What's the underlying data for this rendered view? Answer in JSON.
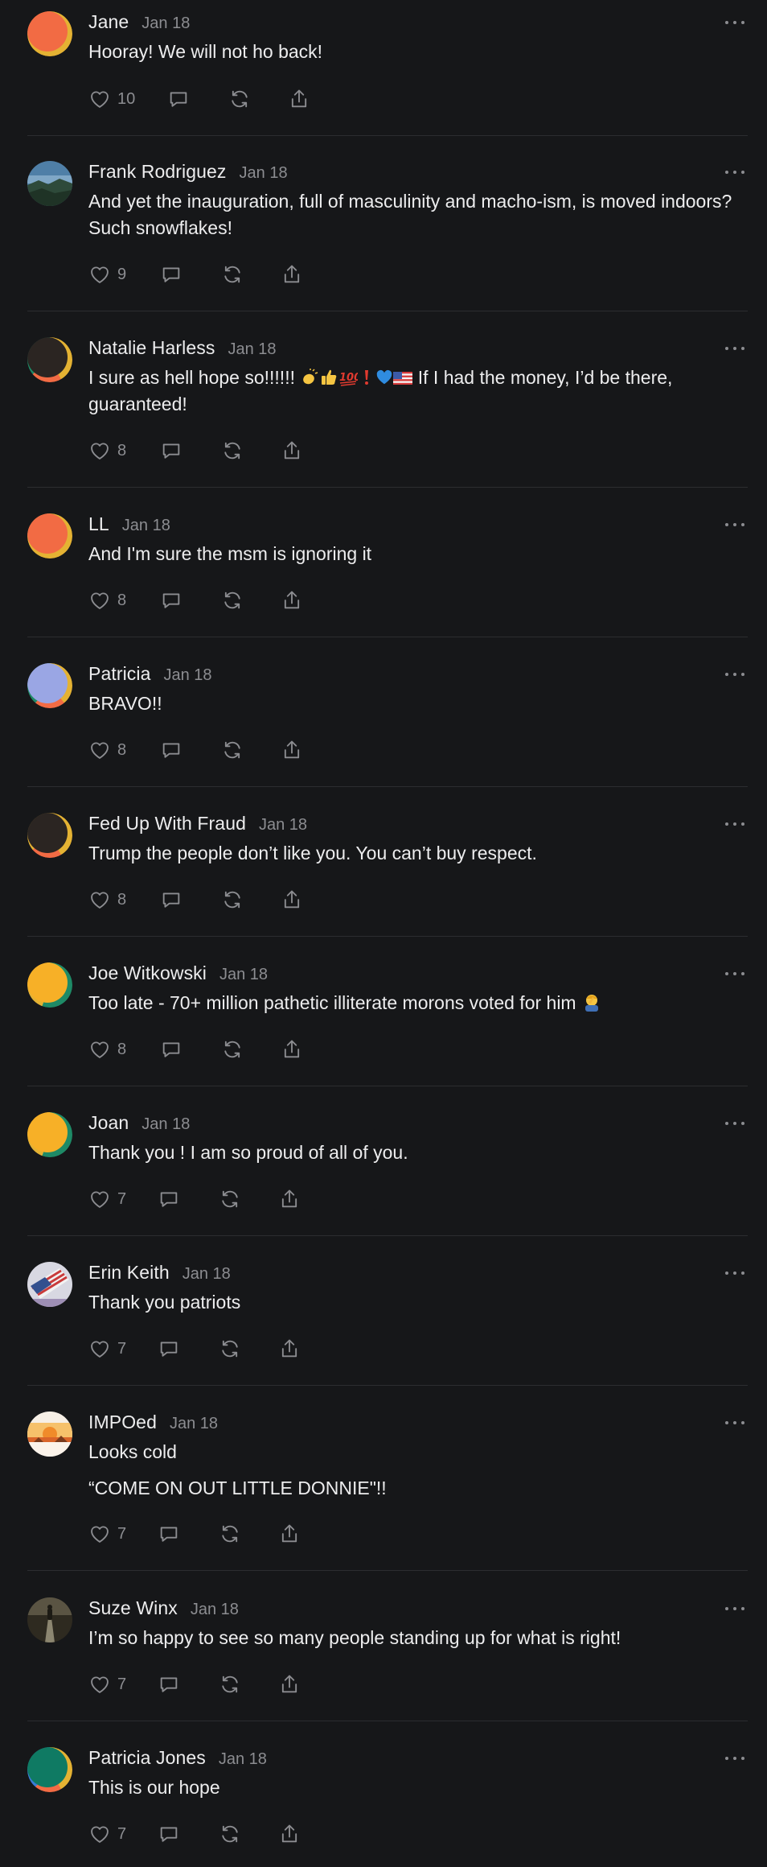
{
  "comments": [
    {
      "name": "Jane",
      "date": "Jan 18",
      "text": [
        "Hooray! We will not ho back!"
      ],
      "likes": "10",
      "avatar": {
        "ring": "#e4b233",
        "face": "#f26b44"
      }
    },
    {
      "name": "Frank Rodriguez",
      "date": "Jan 18",
      "text": [
        "And yet the inauguration, full of masculinity and macho-ism, is moved indoors? Such snowflakes!"
      ],
      "likes": "9",
      "avatar": {
        "ring": "#395a7a",
        "face": "#3a5f78",
        "photo": "landscape"
      }
    },
    {
      "name": "Natalie Harless",
      "date": "Jan 18",
      "text_main": "I sure as hell hope so!!!!!! ",
      "text_tail": " If I had the money, I’d be there, guaranteed!",
      "likes": "8",
      "avatar": {
        "ring": "#e4b233",
        "face": "#2b2522"
      }
    },
    {
      "name": "LL",
      "date": "Jan 18",
      "text": [
        "And I'm sure the msm is ignoring it"
      ],
      "likes": "8",
      "avatar": {
        "ring": "#e4b233",
        "face": "#f26b44"
      }
    },
    {
      "name": "Patricia",
      "date": "Jan 18",
      "text": [
        "BRAVO!!"
      ],
      "likes": "8",
      "avatar": {
        "ring": "#e4b233",
        "face": "#9aa6e4"
      }
    },
    {
      "name": "Fed Up With Fraud",
      "date": "Jan 18",
      "text": [
        "Trump the people don’t like you. You can’t buy respect."
      ],
      "likes": "8",
      "avatar": {
        "ring": "#e4b233",
        "face": "#2b2522"
      }
    },
    {
      "name": "Joe Witkowski",
      "date": "Jan 18",
      "text_main": "Too late - 70+ million pathetic illiterate morons voted for him ",
      "likes": "8",
      "avatar": {
        "ring": "#1e8a66",
        "face": "#f7b027"
      }
    },
    {
      "name": "Joan",
      "date": "Jan 18",
      "text": [
        "Thank you ! I am so proud of all of you."
      ],
      "likes": "7",
      "avatar": {
        "ring": "#1e8a66",
        "face": "#f7b027"
      }
    },
    {
      "name": "Erin Keith",
      "date": "Jan 18",
      "text": [
        "Thank you patriots"
      ],
      "likes": "7",
      "avatar": {
        "ring": "#c9c9d6",
        "face": "#d9d9e6",
        "photo": "flag"
      }
    },
    {
      "name": "IMPOed",
      "date": "Jan 18",
      "text": [
        "Looks cold",
        "“COME ON OUT LITTLE DONNIE\"!!"
      ],
      "likes": "7",
      "avatar": {
        "ring": "#f1d6a0",
        "face": "#f2c67a",
        "photo": "sunset"
      }
    },
    {
      "name": "Suze Winx",
      "date": "Jan 18",
      "text": [
        "I’m so happy to see so many people standing up for what is right!"
      ],
      "likes": "7",
      "avatar": {
        "ring": "#3a3528",
        "face": "#4c4535",
        "photo": "road"
      }
    },
    {
      "name": "Patricia Jones",
      "date": "Jan 18",
      "text": [
        "This is our hope"
      ],
      "likes": "7",
      "avatar": {
        "ring": "#e4b233",
        "face": "#0f7a63"
      }
    }
  ]
}
